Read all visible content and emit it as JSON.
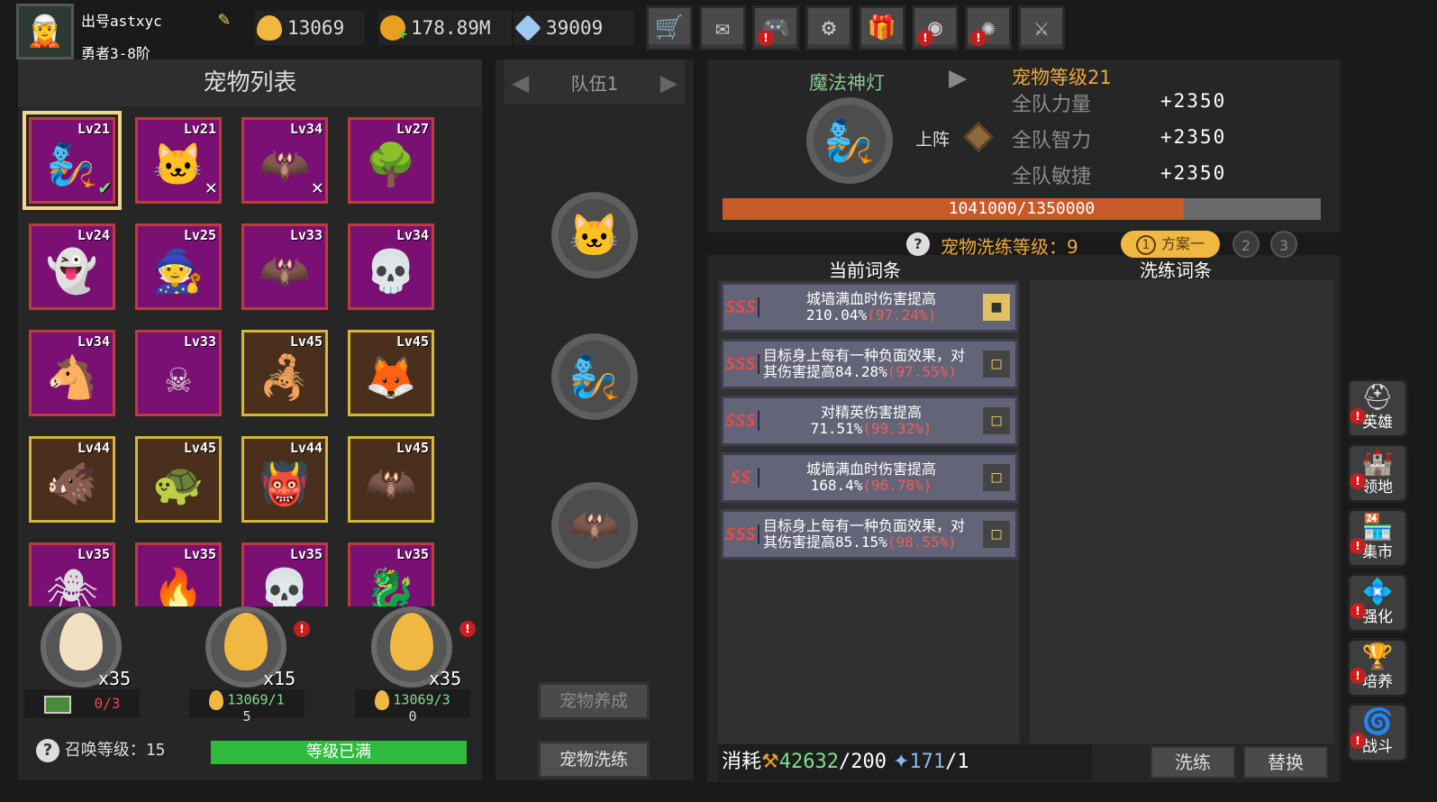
{
  "player": {
    "name": "出号astxyc",
    "rank": "勇者3-8阶",
    "avatar_icon": "elf-hero-avatar"
  },
  "resources": [
    {
      "name": "egg",
      "value": "13069",
      "color": "#f0b840"
    },
    {
      "name": "gold",
      "value": "178.89M",
      "color": "#e8a020"
    },
    {
      "name": "crystal",
      "value": "39009",
      "color": "#9ec8f0"
    }
  ],
  "toolbar": [
    {
      "icon": "cart-icon",
      "glyph": "🛒",
      "alert": false
    },
    {
      "icon": "mail-icon",
      "glyph": "✉",
      "alert": false
    },
    {
      "icon": "gamepad-icon",
      "glyph": "🎮",
      "alert": true
    },
    {
      "icon": "settings-icon",
      "glyph": "⚙",
      "alert": false
    },
    {
      "icon": "gift-icon",
      "glyph": "🎁",
      "alert": false
    },
    {
      "icon": "wheel-icon",
      "glyph": "◉",
      "alert": true
    },
    {
      "icon": "burst-icon",
      "glyph": "✺",
      "alert": true
    },
    {
      "icon": "swords-icon",
      "glyph": "⚔",
      "alert": false
    }
  ],
  "pet_list": {
    "title": "宠物列表",
    "pets": [
      {
        "lv": "Lv21",
        "name": "genie",
        "glyph": "🧞",
        "rarity": "purple",
        "mark": "check",
        "selected": true
      },
      {
        "lv": "Lv21",
        "name": "white-cat",
        "glyph": "🐱",
        "rarity": "purple",
        "mark": "x"
      },
      {
        "lv": "Lv34",
        "name": "bat",
        "glyph": "🦇",
        "rarity": "purple",
        "mark": "x"
      },
      {
        "lv": "Lv27",
        "name": "treant",
        "glyph": "🌳",
        "rarity": "purple",
        "mark": ""
      },
      {
        "lv": "Lv24",
        "name": "ghost",
        "glyph": "👻",
        "rarity": "purple",
        "mark": ""
      },
      {
        "lv": "Lv25",
        "name": "witch",
        "glyph": "🧙",
        "rarity": "purple",
        "mark": ""
      },
      {
        "lv": "Lv33",
        "name": "gremlin",
        "glyph": "🦇",
        "rarity": "purple",
        "mark": ""
      },
      {
        "lv": "Lv34",
        "name": "reaper",
        "glyph": "💀",
        "rarity": "purple",
        "mark": ""
      },
      {
        "lv": "Lv34",
        "name": "pony",
        "glyph": "🐴",
        "rarity": "purple",
        "mark": ""
      },
      {
        "lv": "Lv33",
        "name": "lantern-skull",
        "glyph": "☠",
        "rarity": "purple",
        "mark": ""
      },
      {
        "lv": "Lv45",
        "name": "scorpion",
        "glyph": "🦂",
        "rarity": "gold",
        "mark": ""
      },
      {
        "lv": "Lv45",
        "name": "ice-fox",
        "glyph": "🦊",
        "rarity": "gold",
        "mark": ""
      },
      {
        "lv": "Lv44",
        "name": "lava-beast",
        "glyph": "🐗",
        "rarity": "gold",
        "mark": ""
      },
      {
        "lv": "Lv45",
        "name": "turtle",
        "glyph": "🐢",
        "rarity": "gold",
        "mark": ""
      },
      {
        "lv": "Lv44",
        "name": "demon-lord",
        "glyph": "👹",
        "rarity": "gold",
        "mark": ""
      },
      {
        "lv": "Lv45",
        "name": "shadow-bat",
        "glyph": "🦇",
        "rarity": "gold",
        "mark": ""
      },
      {
        "lv": "Lv35",
        "name": "spider",
        "glyph": "🕷",
        "rarity": "purple",
        "mark": ""
      },
      {
        "lv": "Lv35",
        "name": "fire-spirit",
        "glyph": "🔥",
        "rarity": "purple",
        "mark": ""
      },
      {
        "lv": "Lv35",
        "name": "skeleton",
        "glyph": "💀",
        "rarity": "purple",
        "mark": ""
      },
      {
        "lv": "Lv35",
        "name": "pink-dragon",
        "glyph": "🐉",
        "rarity": "purple",
        "mark": ""
      }
    ]
  },
  "eggs": [
    {
      "count": "x35",
      "cost": "0/3",
      "color": "#f0e0c0",
      "alert": false,
      "has_video": true
    },
    {
      "count": "x15",
      "cost": "13069/1",
      "cost_line2": "5",
      "color": "#f0b840",
      "alert": true,
      "has_video": false
    },
    {
      "count": "x35",
      "cost": "13069/3",
      "cost_line2": "0",
      "color": "#f0b840",
      "alert": true,
      "has_video": false
    }
  ],
  "summon": {
    "label": "召唤等级：",
    "level": "15",
    "bar_text": "等级已满"
  },
  "team": {
    "label": "队伍1",
    "slots": [
      "🐱",
      "🧞",
      "🦇"
    ],
    "btn_train": "宠物养成",
    "btn_refine": "宠物洗练"
  },
  "detail": {
    "name": "魔法神灯",
    "glyph": "🧞",
    "pet_level": "宠物等级21",
    "deploy": "上阵",
    "stats": [
      {
        "label": "全队力量",
        "value": "+2350"
      },
      {
        "label": "全队智力",
        "value": "+2350"
      },
      {
        "label": "全队敏捷",
        "value": "+2350"
      }
    ],
    "xp_text": "1041000/1350000",
    "xp_progress": 0.771
  },
  "refine": {
    "level_label": "宠物洗练等级：",
    "level": "9",
    "plans": [
      {
        "num": "1",
        "name": "方案一",
        "active": true
      },
      {
        "num": "2",
        "active": false
      },
      {
        "num": "3",
        "active": false
      }
    ],
    "current_header": "当前词条",
    "new_header": "洗练词条",
    "affixes": [
      {
        "rank": "SSS",
        "line1": "城墙满血时伤害提高",
        "val": "210.04%",
        "pct": "(97.24%)",
        "locked": true
      },
      {
        "rank": "SSS",
        "line1": "目标身上每有一种负面效果，对",
        "line2": "其伤害提高",
        "val": "84.28%",
        "pct": "(97.55%)",
        "locked": false
      },
      {
        "rank": "SSS",
        "line1": "对精英伤害提高",
        "val": "71.51%",
        "pct": "(99.32%)",
        "locked": false
      },
      {
        "rank": "SS",
        "line1": "城墙满血时伤害提高",
        "val": "168.4%",
        "pct": "(96.78%)",
        "locked": false
      },
      {
        "rank": "SSS",
        "line1": "目标身上每有一种负面效果，对",
        "line2": "其伤害提高",
        "val": "85.15%",
        "pct": "(98.55%)",
        "locked": false
      }
    ],
    "cost_label": "消耗",
    "cost_gold": "42632",
    "cost_gold_req": "/200",
    "cost_crystal": "171",
    "cost_crystal_req": "/1",
    "btn_refine": "洗练",
    "btn_replace": "替换"
  },
  "side_menu": [
    {
      "label": "英雄",
      "icon": "helmet-icon",
      "glyph": "⛑"
    },
    {
      "label": "领地",
      "icon": "castle-icon",
      "glyph": "🏰"
    },
    {
      "label": "集市",
      "icon": "shop-icon",
      "glyph": "🏪"
    },
    {
      "label": "强化",
      "icon": "gem-icon",
      "glyph": "💠"
    },
    {
      "label": "培养",
      "icon": "chalice-icon",
      "glyph": "🏆"
    },
    {
      "label": "战斗",
      "icon": "portal-icon",
      "glyph": "🌀"
    }
  ]
}
